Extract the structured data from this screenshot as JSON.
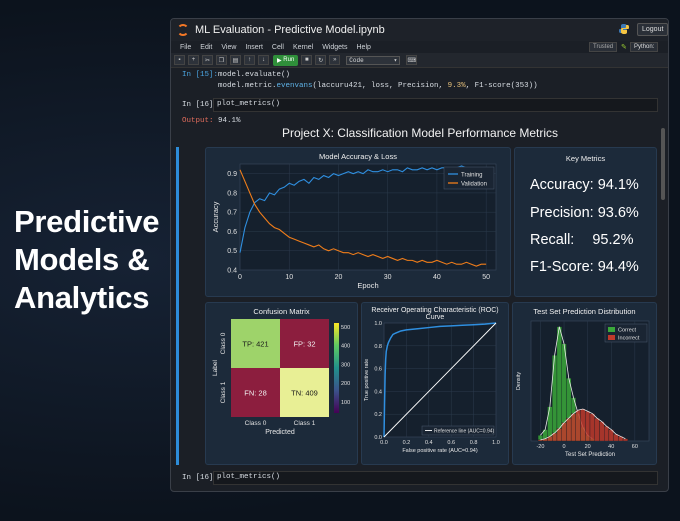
{
  "promo": {
    "lines": [
      "Predictive",
      "Models &",
      "Analytics"
    ]
  },
  "window": {
    "title": "ML Evaluation - Predictive Model.ipynb",
    "logout": "Logout",
    "trusted": "Trusted",
    "kernel": "Python:"
  },
  "menu": [
    "File",
    "Edit",
    "View",
    "Insert",
    "Cell",
    "Kernel",
    "Widgets",
    "Help"
  ],
  "toolbar": {
    "run_label": "Run",
    "cell_type": "Code"
  },
  "cells": {
    "c15_prompt": "In [15]:",
    "c15_line1": "model.evaluate()",
    "c15_line2a": "model.metric.",
    "c15_line2b": "evenvans",
    "c15_line2c": "(laccuru421, loss, Precision, ",
    "c15_line2d": "9.3%",
    "c15_line2e": ", F1-score(353))",
    "c16_prompt": "In [16]:",
    "c16_code": "plot_metrics()",
    "out_prompt": "Output:",
    "out_value": "94.1%",
    "bottom_prompt": "In [16]:",
    "bottom_code": "plot_metrics()"
  },
  "report": {
    "title": "Project X: Classification Model Performance Metrics"
  },
  "key_metrics": {
    "title": "Key Metrics",
    "items": [
      {
        "label": "Accuracy:",
        "value": "94.1%"
      },
      {
        "label": "Precision:",
        "value": "93.6%"
      },
      {
        "label": "Recall:",
        "value": "95.2%"
      },
      {
        "label": "F1-Score:",
        "value": "94.4%"
      }
    ]
  },
  "chart_data": [
    {
      "type": "line",
      "title": "Model Accuracy & Loss",
      "xlabel": "Epoch",
      "ylabel": "Accuracy",
      "xlim": [
        0,
        52
      ],
      "ylim": [
        0.4,
        0.95
      ],
      "xticks": [
        0,
        10,
        20,
        30,
        40,
        50
      ],
      "yticks": [
        0.4,
        0.5,
        0.6,
        0.7,
        0.8,
        0.9
      ],
      "legend": "top-right",
      "grid": true,
      "series": [
        {
          "name": "Training",
          "color": "#2f8fe0",
          "x": [
            0,
            1,
            2,
            3,
            4,
            5,
            6,
            7,
            8,
            9,
            10,
            11,
            12,
            13,
            14,
            15,
            16,
            17,
            18,
            19,
            20,
            21,
            22,
            23,
            24,
            25,
            26,
            27,
            28,
            29,
            30,
            31,
            32,
            33,
            34,
            35,
            36,
            37,
            38,
            39,
            40,
            41,
            42,
            43,
            44,
            45,
            46,
            47,
            48,
            49,
            50
          ],
          "y": [
            0.49,
            0.62,
            0.7,
            0.75,
            0.77,
            0.76,
            0.8,
            0.79,
            0.82,
            0.83,
            0.85,
            0.84,
            0.86,
            0.87,
            0.85,
            0.88,
            0.87,
            0.89,
            0.88,
            0.9,
            0.89,
            0.9,
            0.91,
            0.9,
            0.91,
            0.9,
            0.92,
            0.91,
            0.91,
            0.92,
            0.91,
            0.92,
            0.92,
            0.91,
            0.93,
            0.92,
            0.92,
            0.93,
            0.92,
            0.93,
            0.92,
            0.93,
            0.93,
            0.92,
            0.93,
            0.94,
            0.93,
            0.92,
            0.93,
            0.93,
            0.93
          ]
        },
        {
          "name": "Validation",
          "color": "#f07d1a",
          "x": [
            0,
            1,
            2,
            3,
            4,
            5,
            6,
            7,
            8,
            9,
            10,
            11,
            12,
            13,
            14,
            15,
            16,
            17,
            18,
            19,
            20,
            21,
            22,
            23,
            24,
            25,
            26,
            27,
            28,
            29,
            30,
            31,
            32,
            33,
            34,
            35,
            36,
            37,
            38,
            39,
            40,
            41,
            42,
            43,
            44,
            45,
            46,
            47,
            48,
            49,
            50
          ],
          "y": [
            0.92,
            0.86,
            0.8,
            0.74,
            0.7,
            0.67,
            0.64,
            0.62,
            0.61,
            0.59,
            0.57,
            0.56,
            0.55,
            0.54,
            0.53,
            0.52,
            0.53,
            0.51,
            0.5,
            0.51,
            0.5,
            0.49,
            0.49,
            0.48,
            0.49,
            0.48,
            0.47,
            0.48,
            0.47,
            0.46,
            0.47,
            0.46,
            0.45,
            0.46,
            0.45,
            0.45,
            0.44,
            0.45,
            0.44,
            0.44,
            0.45,
            0.44,
            0.43,
            0.44,
            0.43,
            0.43,
            0.44,
            0.43,
            0.42,
            0.43,
            0.43
          ]
        }
      ]
    },
    {
      "type": "heatmap",
      "title": "Confusion Matrix",
      "xlabel": "Predicted",
      "ylabel": "Label",
      "x_categories": [
        "Class 0",
        "Class 1"
      ],
      "y_categories": [
        "Class 0",
        "Class 1"
      ],
      "cells": [
        {
          "label": "TP: 421",
          "value": 421,
          "color": "#9ed36a"
        },
        {
          "label": "FP: 32",
          "value": 32,
          "color": "#8c1e3e"
        },
        {
          "label": "FN: 28",
          "value": 28,
          "color": "#8c1e3e"
        },
        {
          "label": "TN: 409",
          "value": 409,
          "color": "#e8ef95"
        }
      ],
      "colorbar_ticks": [
        100,
        200,
        300,
        400,
        500
      ]
    },
    {
      "type": "line",
      "title": "Receiver Operating Characteristic (ROC) Curve",
      "xlabel": "False positive rate (AUC=0.94)",
      "ylabel": "True positive rate",
      "xlim": [
        0,
        1
      ],
      "ylim": [
        0,
        1
      ],
      "xticks": [
        0.0,
        0.2,
        0.4,
        0.6,
        0.8,
        1.0
      ],
      "yticks": [
        0.0,
        0.2,
        0.4,
        0.6,
        0.8,
        1.0
      ],
      "legend": "bottom-right",
      "series": [
        {
          "name": "ROC",
          "color": "#2f8fe0",
          "x": [
            0,
            0.005,
            0.01,
            0.015,
            0.02,
            0.03,
            0.04,
            0.06,
            0.08,
            0.1,
            0.15,
            0.2,
            0.3,
            0.4,
            0.5,
            0.6,
            0.7,
            0.8,
            0.9,
            1.0
          ],
          "y": [
            0,
            0.3,
            0.55,
            0.68,
            0.75,
            0.8,
            0.83,
            0.87,
            0.9,
            0.91,
            0.93,
            0.94,
            0.95,
            0.96,
            0.97,
            0.975,
            0.98,
            0.985,
            0.99,
            1.0
          ]
        },
        {
          "name": "Reference line (AUC=0.94)",
          "color": "#ffffff",
          "x": [
            0,
            1
          ],
          "y": [
            0,
            1
          ]
        }
      ]
    },
    {
      "type": "bar",
      "title": "Test Set Prediction Distribution",
      "xlabel": "Test Set Prediction",
      "ylabel": "Density",
      "xlim": [
        -28,
        72
      ],
      "xticks": [
        -20,
        0,
        20,
        40,
        60
      ],
      "legend": "top-right",
      "series": [
        {
          "name": "Correct",
          "color": "#3aa83a",
          "x": [
            -20,
            -16,
            -12,
            -8,
            -4,
            0,
            4,
            8,
            12,
            16,
            20,
            24
          ],
          "values": [
            0.05,
            0.1,
            0.3,
            0.75,
            1.0,
            0.85,
            0.55,
            0.38,
            0.24,
            0.12,
            0.05,
            0.02
          ]
        },
        {
          "name": "Incorrect",
          "color": "#c0392b",
          "x": [
            -20,
            -16,
            -12,
            -8,
            -4,
            0,
            4,
            8,
            12,
            16,
            20,
            24,
            28,
            32,
            36,
            40,
            44,
            48,
            52
          ],
          "values": [
            0.01,
            0.02,
            0.04,
            0.07,
            0.11,
            0.16,
            0.2,
            0.24,
            0.27,
            0.28,
            0.26,
            0.24,
            0.2,
            0.17,
            0.13,
            0.1,
            0.06,
            0.04,
            0.02
          ]
        }
      ]
    }
  ]
}
